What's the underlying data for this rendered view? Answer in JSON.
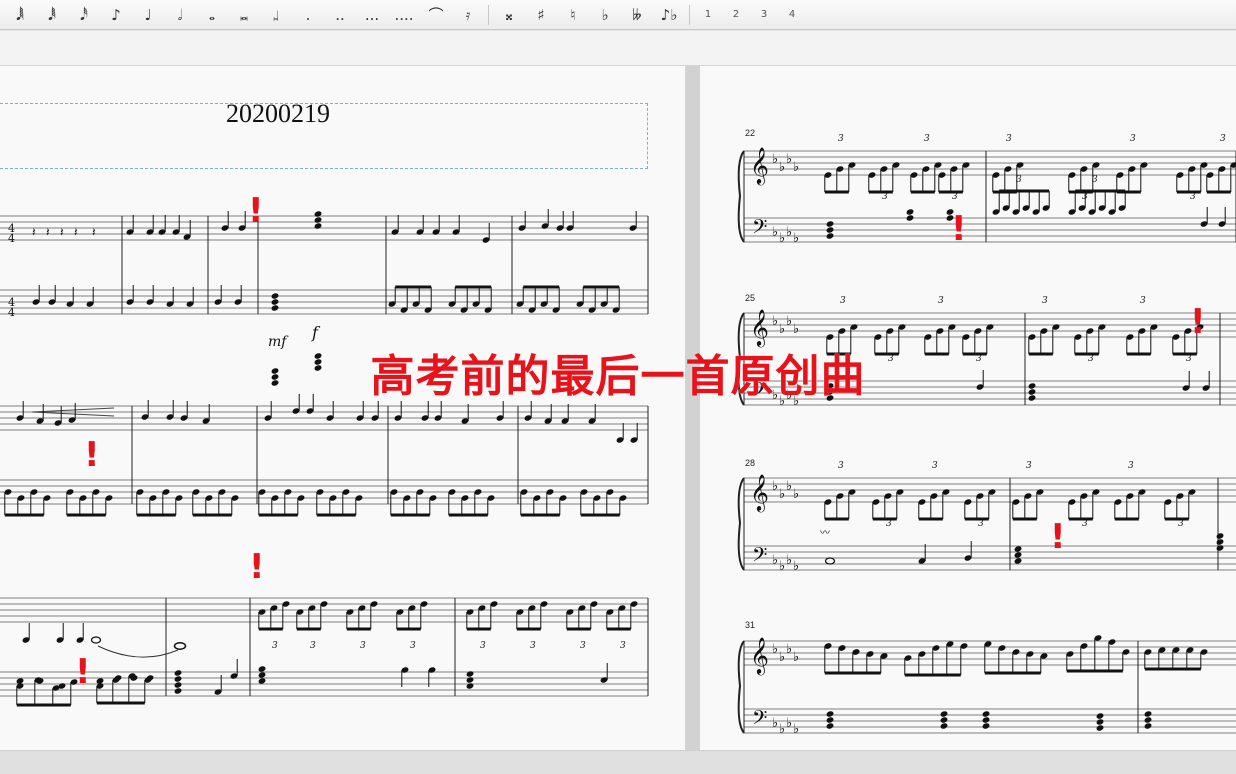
{
  "toolbar": {
    "note_buttons": [
      {
        "glyph": "𝅘𝅥𝅲",
        "name": "64th-note-icon"
      },
      {
        "glyph": "𝅘𝅥𝅱",
        "name": "32nd-note-icon"
      },
      {
        "glyph": "𝅘𝅥𝅰",
        "name": "16th-note-icon"
      },
      {
        "glyph": "♪",
        "name": "eighth-note-icon"
      },
      {
        "glyph": "♩",
        "name": "quarter-note-icon"
      },
      {
        "glyph": "𝅗𝅥",
        "name": "half-note-icon"
      },
      {
        "glyph": "𝅝",
        "name": "whole-note-icon"
      },
      {
        "glyph": "𝅜",
        "name": "breve-note-icon"
      },
      {
        "glyph": "𝆷",
        "name": "longa-note-icon"
      }
    ],
    "dot_buttons": [
      ".",
      "..",
      "...",
      "...."
    ],
    "other_buttons": [
      {
        "glyph": "⌒",
        "name": "tie-icon"
      },
      {
        "glyph": "𝄿",
        "name": "tuplet-icon"
      }
    ],
    "accidental_buttons": [
      {
        "glyph": "𝄪",
        "name": "double-sharp-icon"
      },
      {
        "glyph": "♯",
        "name": "sharp-icon"
      },
      {
        "glyph": "♮",
        "name": "natural-icon"
      },
      {
        "glyph": "♭",
        "name": "flat-icon"
      },
      {
        "glyph": "𝄫",
        "name": "double-flat-icon"
      },
      {
        "glyph": "♪♭",
        "name": "grace-flat-icon"
      }
    ],
    "voice_buttons": [
      "1",
      "2",
      "3",
      "4"
    ]
  },
  "score": {
    "title": "20200219",
    "dynamic_mf": "mf",
    "dynamic_f": "f",
    "time_signature_top": "4",
    "time_signature_bottom": "4",
    "measure_numbers": [
      "22",
      "25",
      "28",
      "31"
    ],
    "tuplet_label": "3"
  },
  "overlay": {
    "caption": "高考前的最后一首原创曲",
    "mark": "!"
  }
}
